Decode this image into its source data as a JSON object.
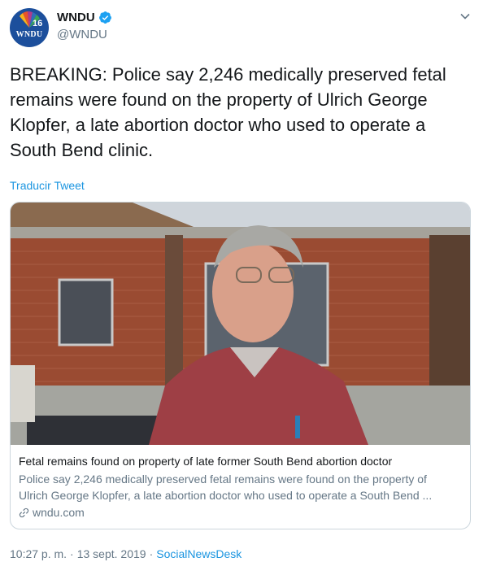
{
  "header": {
    "display_name": "WNDU",
    "handle": "@WNDU",
    "avatar_text": "WNDU"
  },
  "tweet": {
    "text": "BREAKING: Police say 2,246 medically preserved fetal remains were found on the property of Ulrich George Klopfer, a late abortion doctor who used to operate a South Bend clinic.",
    "translate_label": "Traducir Tweet"
  },
  "card": {
    "title": "Fetal remains found on property of late former South Bend abortion doctor",
    "description_line1": "Police say 2,246 medically preserved fetal remains were found on the property of",
    "description_line2": "Ulrich George Klopfer, a late abortion doctor who used to operate a South Bend ...",
    "domain": "wndu.com"
  },
  "footer": {
    "time": "10:27 p. m.",
    "separator": "·",
    "date": "13 sept. 2019",
    "separator2": "·",
    "source": "SocialNewsDesk"
  },
  "colors": {
    "link": "#1b95e0",
    "secondary": "#657786",
    "border": "#ccd6dd",
    "verified": "#1da1f2"
  }
}
